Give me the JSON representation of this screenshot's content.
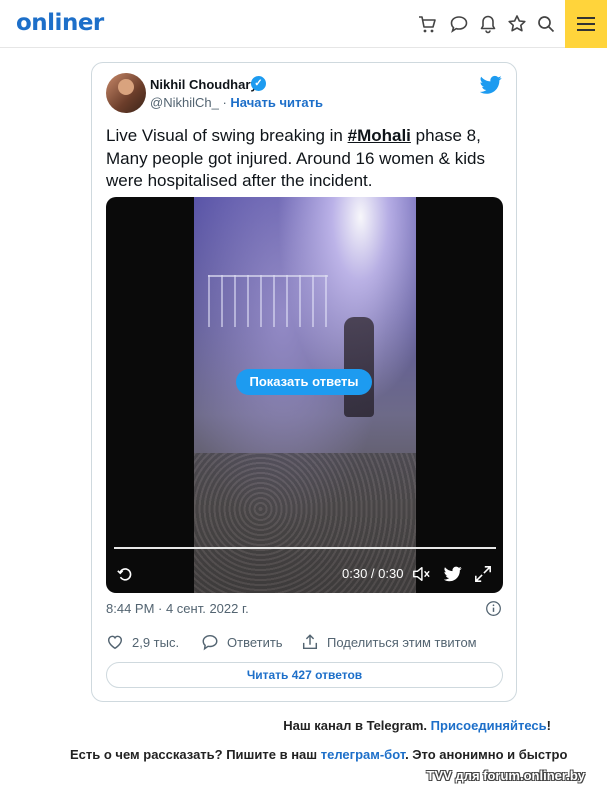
{
  "header": {
    "logo": "onliner",
    "icons": [
      "cart-icon",
      "chat-icon",
      "bell-icon",
      "star-icon",
      "search-icon",
      "menu-icon"
    ]
  },
  "tweet": {
    "author_name": "Nikhil Choudhary",
    "handle": "@NikhilCh_",
    "separator": "·",
    "follow_label": "Начать читать",
    "text_before": "Live Visual of swing breaking in ",
    "hashtag": "#Mohali",
    "text_after": " phase 8, Many people got injured. Around 16 women & kids were hospitalised after the incident.",
    "video": {
      "overlay_button": "Показать ответы",
      "time": "0:30 / 0:30",
      "progress": 1.0
    },
    "timestamp": "8:44 PM · 4 сент. 2022 г.",
    "likes": "2,9 тыс.",
    "reply_label": "Ответить",
    "share_label": "Поделиться этим твитом",
    "read_replies_label": "Читать 427 ответов"
  },
  "footer": {
    "tg_prefix": "Наш канал в Telegram. ",
    "tg_link": "Присоединяйтесь",
    "tg_suffix": "!",
    "bot_prefix": "Есть о чем рассказать? Пишите в наш ",
    "bot_link": "телеграм-бот",
    "bot_suffix": ". Это анонимно и быстро",
    "watermark": "TVV для forum.onliner.by"
  },
  "colors": {
    "brand": "#1d6fc9",
    "twitter": "#1d9bf0",
    "menu_bg": "#ffd43b"
  }
}
